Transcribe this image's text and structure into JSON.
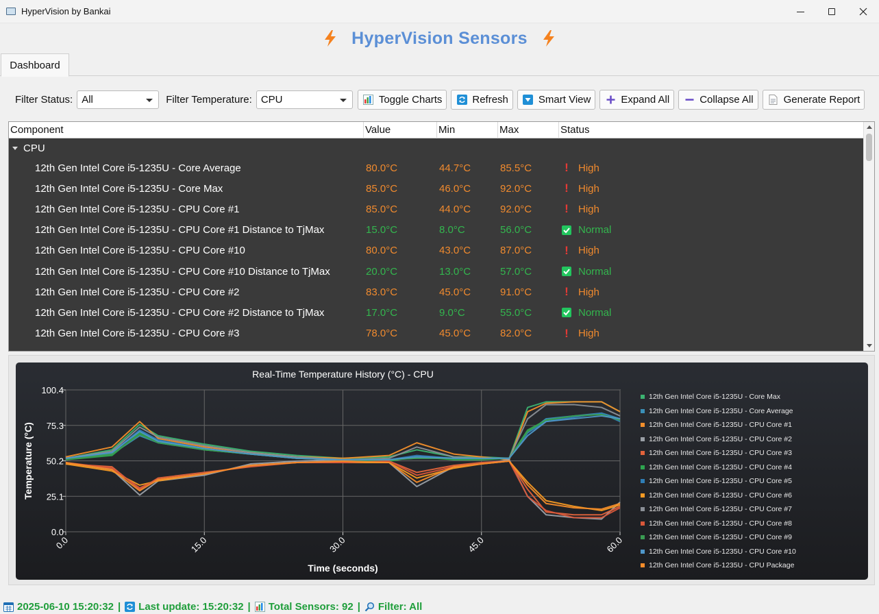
{
  "window": {
    "title": "HyperVision by Bankai"
  },
  "header": {
    "title": "HyperVision Sensors"
  },
  "tabs": [
    {
      "label": "Dashboard"
    }
  ],
  "toolbar": {
    "filter_status_label": "Filter Status:",
    "filter_status_value": "All",
    "filter_temp_label": "Filter Temperature:",
    "filter_temp_value": "CPU",
    "buttons": {
      "toggle_charts": "Toggle Charts",
      "refresh": "Refresh",
      "smart_view": "Smart View",
      "expand_all": "Expand All",
      "collapse_all": "Collapse All",
      "generate_report": "Generate Report"
    }
  },
  "tree": {
    "columns": [
      "Component",
      "Value",
      "Min",
      "Max",
      "Status"
    ],
    "category": "CPU",
    "rows": [
      {
        "name": "12th Gen Intel Core i5-1235U - Core Average",
        "value": "80.0°C",
        "min": "44.7°C",
        "max": "85.5°C",
        "status": "High"
      },
      {
        "name": "12th Gen Intel Core i5-1235U - Core Max",
        "value": "85.0°C",
        "min": "46.0°C",
        "max": "92.0°C",
        "status": "High"
      },
      {
        "name": "12th Gen Intel Core i5-1235U - CPU Core #1",
        "value": "85.0°C",
        "min": "44.0°C",
        "max": "92.0°C",
        "status": "High"
      },
      {
        "name": "12th Gen Intel Core i5-1235U - CPU Core #1 Distance to TjMax",
        "value": "15.0°C",
        "min": "8.0°C",
        "max": "56.0°C",
        "status": "Normal"
      },
      {
        "name": "12th Gen Intel Core i5-1235U - CPU Core #10",
        "value": "80.0°C",
        "min": "43.0°C",
        "max": "87.0°C",
        "status": "High"
      },
      {
        "name": "12th Gen Intel Core i5-1235U - CPU Core #10 Distance to TjMax",
        "value": "20.0°C",
        "min": "13.0°C",
        "max": "57.0°C",
        "status": "Normal"
      },
      {
        "name": "12th Gen Intel Core i5-1235U - CPU Core #2",
        "value": "83.0°C",
        "min": "45.0°C",
        "max": "91.0°C",
        "status": "High"
      },
      {
        "name": "12th Gen Intel Core i5-1235U - CPU Core #2 Distance to TjMax",
        "value": "17.0°C",
        "min": "9.0°C",
        "max": "55.0°C",
        "status": "Normal"
      },
      {
        "name": "12th Gen Intel Core i5-1235U - CPU Core #3",
        "value": "78.0°C",
        "min": "45.0°C",
        "max": "82.0°C",
        "status": "High"
      }
    ]
  },
  "chart_data": {
    "type": "line",
    "title": "Real-Time Temperature History (°C) - CPU",
    "xlabel": "Time (seconds)",
    "ylabel": "Temperature (°C)",
    "xlim": [
      0,
      60
    ],
    "ylim": [
      0,
      100.4
    ],
    "x_ticks": [
      "0.0",
      "15.0",
      "30.0",
      "45.0",
      "60.0"
    ],
    "y_ticks": [
      "0.0",
      "25.1",
      "50.2",
      "75.3",
      "100.4"
    ],
    "grid": true,
    "legend_position": "right",
    "x": [
      0,
      5,
      8,
      10,
      15,
      20,
      25,
      30,
      35,
      38,
      42,
      45,
      48,
      50,
      52,
      55,
      58,
      60
    ],
    "series": [
      {
        "name": "12th Gen Intel Core i5-1235U - Core Max",
        "color": "#3cb371",
        "values": [
          52,
          58,
          76,
          68,
          62,
          57,
          54,
          52,
          53,
          58,
          53,
          53,
          52,
          88,
          92,
          92,
          92,
          85
        ]
      },
      {
        "name": "12th Gen Intel Core i5-1235U - Core Average",
        "color": "#3a8fb7",
        "values": [
          51,
          55,
          68,
          63,
          58,
          55,
          52,
          51,
          51,
          52,
          52,
          52,
          52,
          70,
          80,
          82,
          84,
          80
        ]
      },
      {
        "name": "12th Gen Intel Core i5-1235U - CPU Core #1",
        "color": "#f28e2b",
        "values": [
          53,
          60,
          78,
          66,
          60,
          56,
          53,
          52,
          54,
          63,
          55,
          53,
          51,
          85,
          91,
          92,
          92,
          85
        ]
      },
      {
        "name": "12th Gen Intel Core i5-1235U - CPU Core #2",
        "color": "#9aa0a6",
        "values": [
          49,
          44,
          26,
          36,
          40,
          48,
          50,
          51,
          49,
          32,
          46,
          48,
          51,
          25,
          12,
          10,
          9,
          21
        ]
      },
      {
        "name": "12th Gen Intel Core i5-1235U - CPU Core #3",
        "color": "#e2633b",
        "values": [
          48,
          46,
          30,
          38,
          42,
          46,
          49,
          50,
          50,
          42,
          47,
          49,
          50,
          30,
          14,
          12,
          12,
          18
        ]
      },
      {
        "name": "12th Gen Intel Core i5-1235U - CPU Core #4",
        "color": "#2ea44f",
        "values": [
          51,
          54,
          70,
          64,
          58,
          55,
          52,
          51,
          50,
          53,
          51,
          51,
          52,
          72,
          79,
          82,
          83,
          79
        ]
      },
      {
        "name": "12th Gen Intel Core i5-1235U - CPU Core #5",
        "color": "#2f7db5",
        "values": [
          52,
          56,
          72,
          65,
          59,
          55,
          52,
          51,
          51,
          54,
          52,
          52,
          52,
          70,
          78,
          81,
          84,
          78
        ]
      },
      {
        "name": "12th Gen Intel Core i5-1235U - CPU Core #6",
        "color": "#f59a23",
        "values": [
          48,
          43,
          33,
          36,
          41,
          47,
          49,
          49,
          49,
          38,
          45,
          48,
          50,
          35,
          22,
          18,
          15,
          19
        ]
      },
      {
        "name": "12th Gen Intel Core i5-1235U - CPU Core #7",
        "color": "#8a8f96",
        "values": [
          52,
          57,
          74,
          67,
          61,
          56,
          53,
          51,
          52,
          60,
          53,
          52,
          52,
          80,
          90,
          90,
          88,
          82
        ]
      },
      {
        "name": "12th Gen Intel Core i5-1235U - CPU Core #8",
        "color": "#d9573a",
        "values": [
          49,
          45,
          31,
          37,
          41,
          47,
          49,
          49,
          50,
          40,
          46,
          48,
          50,
          25,
          15,
          10,
          10,
          17
        ]
      },
      {
        "name": "12th Gen Intel Core i5-1235U - CPU Core #9",
        "color": "#3a9b52",
        "values": [
          51,
          55,
          69,
          63,
          58,
          55,
          52,
          51,
          51,
          52,
          52,
          52,
          52,
          71,
          79,
          82,
          83,
          79
        ]
      },
      {
        "name": "12th Gen Intel Core i5-1235U - CPU Core #10",
        "color": "#4f97c9",
        "values": [
          52,
          56,
          71,
          64,
          59,
          55,
          52,
          51,
          51,
          53,
          52,
          52,
          52,
          68,
          78,
          80,
          82,
          80
        ]
      },
      {
        "name": "12th Gen Intel Core i5-1235U - CPU Package",
        "color": "#f48c2a",
        "values": [
          49,
          44,
          29,
          37,
          41,
          47,
          49,
          50,
          49,
          35,
          46,
          48,
          50,
          33,
          20,
          17,
          16,
          20
        ]
      }
    ]
  },
  "legend_extra": "12th Gen Intel Core i5-1235U - CPU Core #1 Distance to TjMax",
  "status_bar": {
    "datetime": "2025-06-10 15:20:32",
    "last_update": "Last update: 15:20:32",
    "total_sensors": "Total Sensors: 92",
    "filter": "Filter: All",
    "sep": "|"
  }
}
